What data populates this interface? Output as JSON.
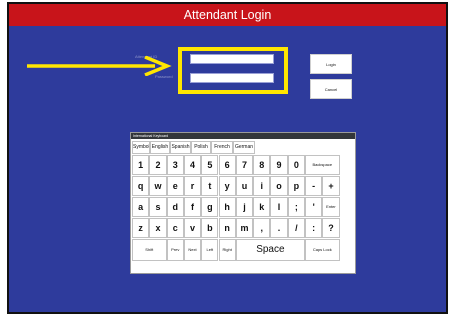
{
  "window": {
    "title": "Attendant Login"
  },
  "login": {
    "attendant_label": "Attendant ID",
    "password_label": "Password",
    "attendant_value": "",
    "password_value": "",
    "login_button": "Login",
    "cancel_button": "Cancel"
  },
  "colors": {
    "title_bar": "#c8141a",
    "background": "#2e3b9c",
    "highlight": "#ffe600"
  },
  "keyboard": {
    "title": "International Keyboard",
    "tabs": [
      "Symbols",
      "English",
      "Spanish",
      "Polish",
      "French",
      "German"
    ],
    "row1": [
      "1",
      "2",
      "3",
      "4",
      "5",
      "6",
      "7",
      "8",
      "9",
      "0",
      "Backspace"
    ],
    "row2": [
      "q",
      "w",
      "e",
      "r",
      "t",
      "y",
      "u",
      "i",
      "o",
      "p",
      "-",
      "+"
    ],
    "row3": [
      "a",
      "s",
      "d",
      "f",
      "g",
      "h",
      "j",
      "k",
      "l",
      ";",
      "'",
      "Enter"
    ],
    "row4": [
      "z",
      "x",
      "c",
      "v",
      "b",
      "n",
      "m",
      ",",
      ".",
      "/",
      ":",
      "?"
    ],
    "row5": [
      "Shift",
      "Prev",
      "Next",
      "Left",
      "Right",
      "Space",
      "Caps Lock"
    ]
  },
  "icons": {
    "arrow": "arrow-right-icon"
  }
}
